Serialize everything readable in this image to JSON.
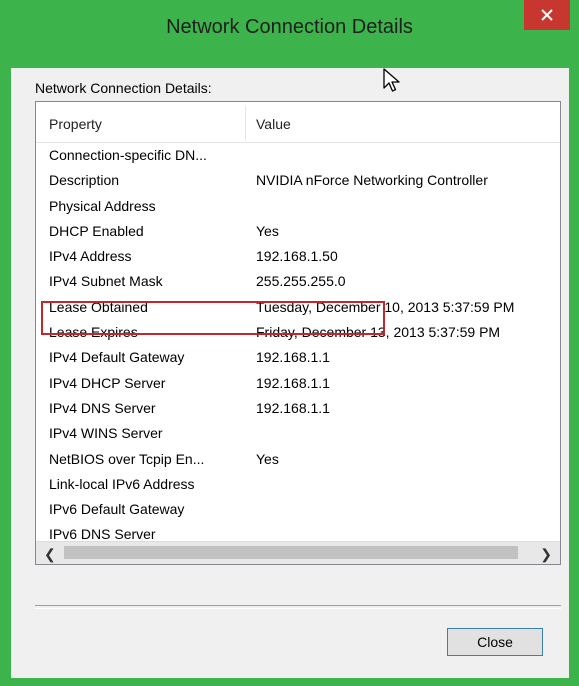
{
  "window": {
    "title": "Network Connection Details",
    "close_icon": "close-icon",
    "accent": "#3cb44b",
    "close_bg": "#c7372f"
  },
  "group_label": "Network Connection Details:",
  "columns": {
    "property": "Property",
    "value": "Value"
  },
  "rows": [
    {
      "property": "Connection-specific DN...",
      "value": ""
    },
    {
      "property": "Description",
      "value": "NVIDIA nForce Networking Controller"
    },
    {
      "property": "Physical Address",
      "value": ""
    },
    {
      "property": "DHCP Enabled",
      "value": "Yes"
    },
    {
      "property": "IPv4 Address",
      "value": "192.168.1.50"
    },
    {
      "property": "IPv4 Subnet Mask",
      "value": "255.255.255.0"
    },
    {
      "property": "Lease Obtained",
      "value": "Tuesday, December 10, 2013 5:37:59 PM"
    },
    {
      "property": "Lease Expires",
      "value": "Friday, December 13, 2013 5:37:59 PM"
    },
    {
      "property": "IPv4 Default Gateway",
      "value": "192.168.1.1"
    },
    {
      "property": "IPv4 DHCP Server",
      "value": "192.168.1.1"
    },
    {
      "property": "IPv4 DNS Server",
      "value": "192.168.1.1"
    },
    {
      "property": "IPv4 WINS Server",
      "value": ""
    },
    {
      "property": "NetBIOS over Tcpip En...",
      "value": "Yes"
    },
    {
      "property": "Link-local IPv6 Address",
      "value": ""
    },
    {
      "property": "IPv6 Default Gateway",
      "value": ""
    },
    {
      "property": "IPv6 DNS Server",
      "value": ""
    }
  ],
  "highlight_color": "#c0282c",
  "scrollbar": {
    "left_icon": "chevron-left-icon",
    "right_icon": "chevron-right-icon"
  },
  "close_button": "Close"
}
